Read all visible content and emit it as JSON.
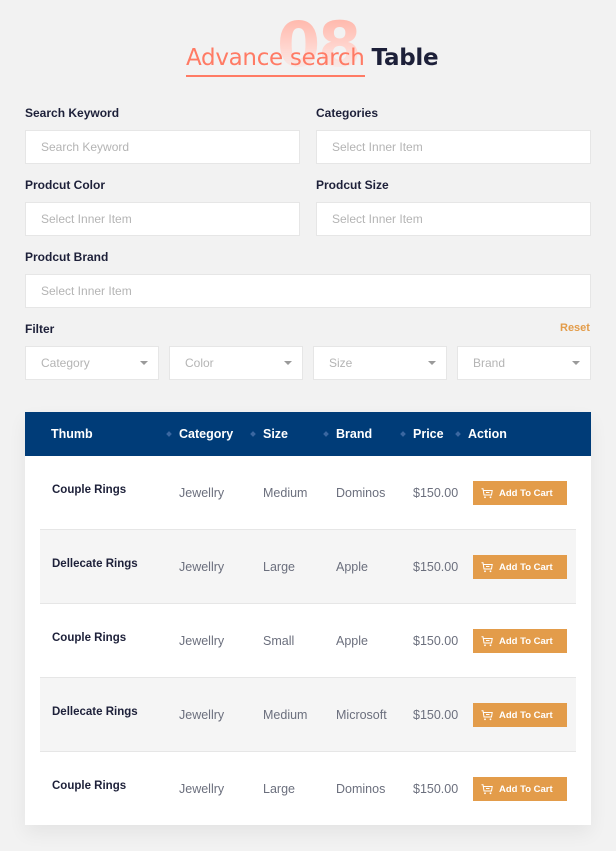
{
  "header": {
    "watermark": "08",
    "title_accent": "Advance search",
    "title_rest": "Table"
  },
  "form": {
    "search_keyword": {
      "label": "Search Keyword",
      "placeholder": "Search Keyword",
      "value": ""
    },
    "categories": {
      "label": "Categories",
      "placeholder": "Select Inner Item",
      "value": ""
    },
    "product_color": {
      "label": "Prodcut Color",
      "placeholder": "Select Inner Item",
      "value": ""
    },
    "product_size": {
      "label": "Prodcut Size",
      "placeholder": "Select Inner Item",
      "value": ""
    },
    "product_brand": {
      "label": "Prodcut Brand",
      "placeholder": "Select Inner Item",
      "value": ""
    }
  },
  "filter": {
    "label": "Filter",
    "reset_label": "Reset",
    "selects": [
      {
        "placeholder": "Category"
      },
      {
        "placeholder": "Color"
      },
      {
        "placeholder": "Size"
      },
      {
        "placeholder": "Brand"
      }
    ]
  },
  "table": {
    "columns": [
      "Thumb",
      "Category",
      "Size",
      "Brand",
      "Price",
      "Action"
    ],
    "rows": [
      {
        "thumb": "Couple Rings",
        "category": "Jewellry",
        "size": "Medium",
        "brand": "Dominos",
        "price": "$150.00",
        "action": "Add To Cart"
      },
      {
        "thumb": "Dellecate Rings",
        "category": "Jewellry",
        "size": "Large",
        "brand": "Apple",
        "price": "$150.00",
        "action": "Add To Cart"
      },
      {
        "thumb": "Couple Rings",
        "category": "Jewellry",
        "size": "Small",
        "brand": "Apple",
        "price": "$150.00",
        "action": "Add To Cart"
      },
      {
        "thumb": "Dellecate Rings",
        "category": "Jewellry",
        "size": "Medium",
        "brand": "Microsoft",
        "price": "$150.00",
        "action": "Add To Cart"
      },
      {
        "thumb": "Couple Rings",
        "category": "Jewellry",
        "size": "Large",
        "brand": "Dominos",
        "price": "$150.00",
        "action": "Add To Cart"
      }
    ]
  },
  "colors": {
    "accent": "#ff7b65",
    "header_bg": "#003c78",
    "button": "#e39c4a",
    "page_bg": "#f2f2f2"
  }
}
